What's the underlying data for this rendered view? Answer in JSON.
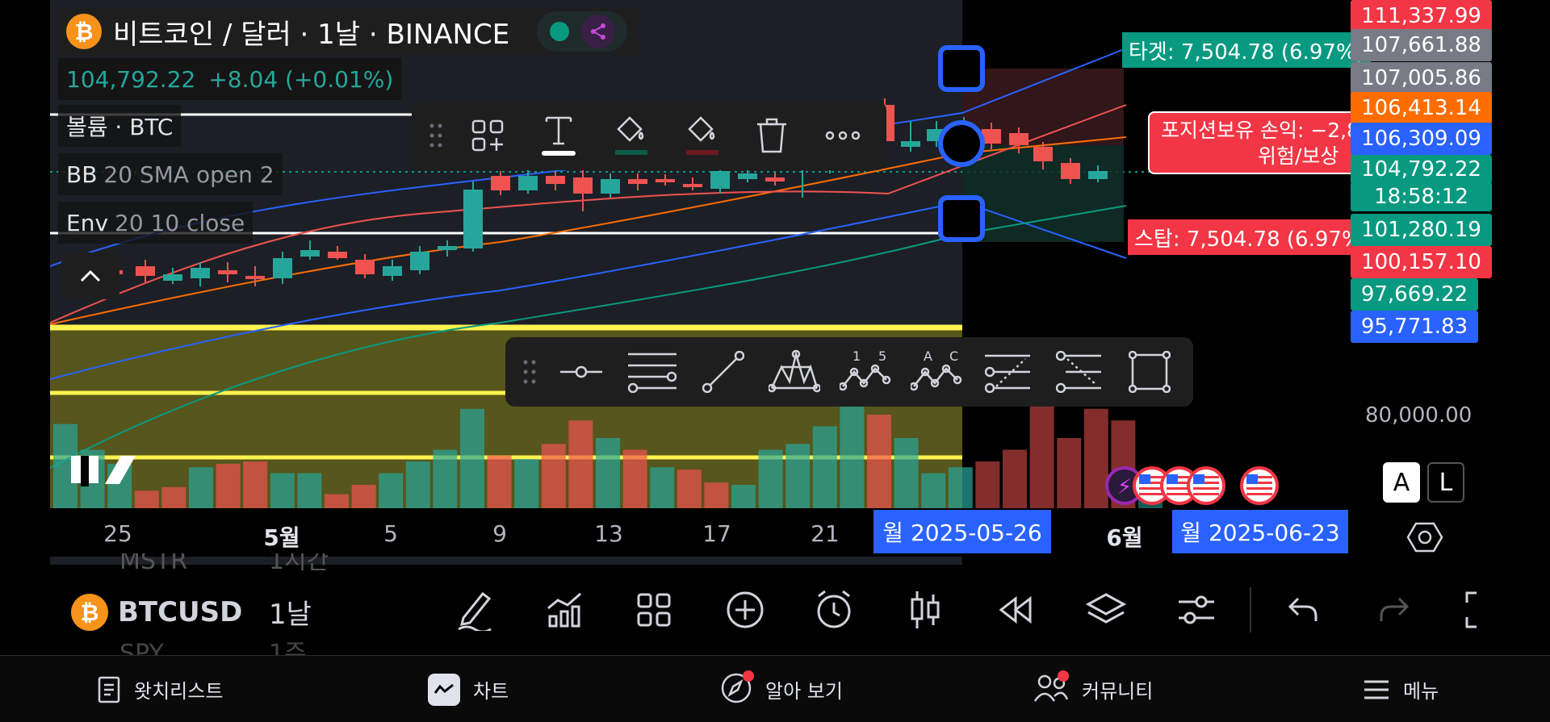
{
  "header": {
    "symbol_title": "비트코인 / 달러 · 1날 · BINANCE",
    "price": "104,792.22",
    "change": "+8.04 (+0.01%)",
    "btc_glyph": "₿"
  },
  "indicators": [
    {
      "name": "볼륨 · BTC",
      "params": ""
    },
    {
      "name": "BB",
      "params": "20 SMA open 2"
    },
    {
      "name": "Env",
      "params": "20 10 close"
    }
  ],
  "position": {
    "target_label": "타겟: 7,504.78 (6.97%)",
    "stop_label": "스탑: 7,504.78 (6.97%)",
    "pnl_line1": "포지션보유 손익: −2,8",
    "pnl_line2": "위험/보상"
  },
  "price_axis": {
    "tags": [
      {
        "value": "111,337.99",
        "color": "#f23645"
      },
      {
        "value": "107,661.88",
        "color": "#787b86"
      },
      {
        "value": "107,005.86",
        "color": "#787b86"
      },
      {
        "value": "106,413.14",
        "color": "#ff6d00"
      },
      {
        "value": "106,309.09",
        "color": "#2962ff"
      },
      {
        "value": "104,792.22",
        "color": "#089981"
      },
      {
        "value": "18:58:12",
        "color": "#089981"
      },
      {
        "value": "101,280.19",
        "color": "#089981"
      },
      {
        "value": "100,157.10",
        "color": "#f23645"
      },
      {
        "value": "97,669.22",
        "color": "#089981"
      },
      {
        "value": "95,771.83",
        "color": "#2962ff"
      }
    ],
    "plain_label": "80,000.00",
    "auto_btn": "A",
    "log_btn": "L"
  },
  "time_axis": {
    "labels": [
      "25",
      "5월",
      "5",
      "9",
      "13",
      "17",
      "21",
      "6월"
    ],
    "range_start": "월 2025-05-26",
    "range_end": "월 2025-06-23"
  },
  "bottom_toolbar": {
    "symbol": "BTCUSD",
    "symbol_prev": "MSTR",
    "symbol_next": "SPY",
    "interval": "1날",
    "interval_prev": "1시간",
    "interval_next": "1주",
    "icons": [
      "pencil-icon",
      "indicators-icon",
      "templates-icon",
      "add-icon",
      "alert-icon",
      "candle-type-icon",
      "replay-icon",
      "layers-icon",
      "settings-icon",
      "undo-icon",
      "redo-icon",
      "fullscreen-icon"
    ]
  },
  "tab_bar": {
    "tabs": [
      {
        "label": "왓치리스트",
        "icon": "watchlist-icon"
      },
      {
        "label": "차트",
        "icon": "chart-icon"
      },
      {
        "label": "알아 보기",
        "icon": "explore-icon"
      },
      {
        "label": "커뮤니티",
        "icon": "community-icon"
      },
      {
        "label": "메뉴",
        "icon": "menu-icon"
      }
    ]
  },
  "colors": {
    "up": "#26a69a",
    "down": "#ef5350",
    "accent": "#2962ff",
    "highlight": "#fff34f"
  }
}
